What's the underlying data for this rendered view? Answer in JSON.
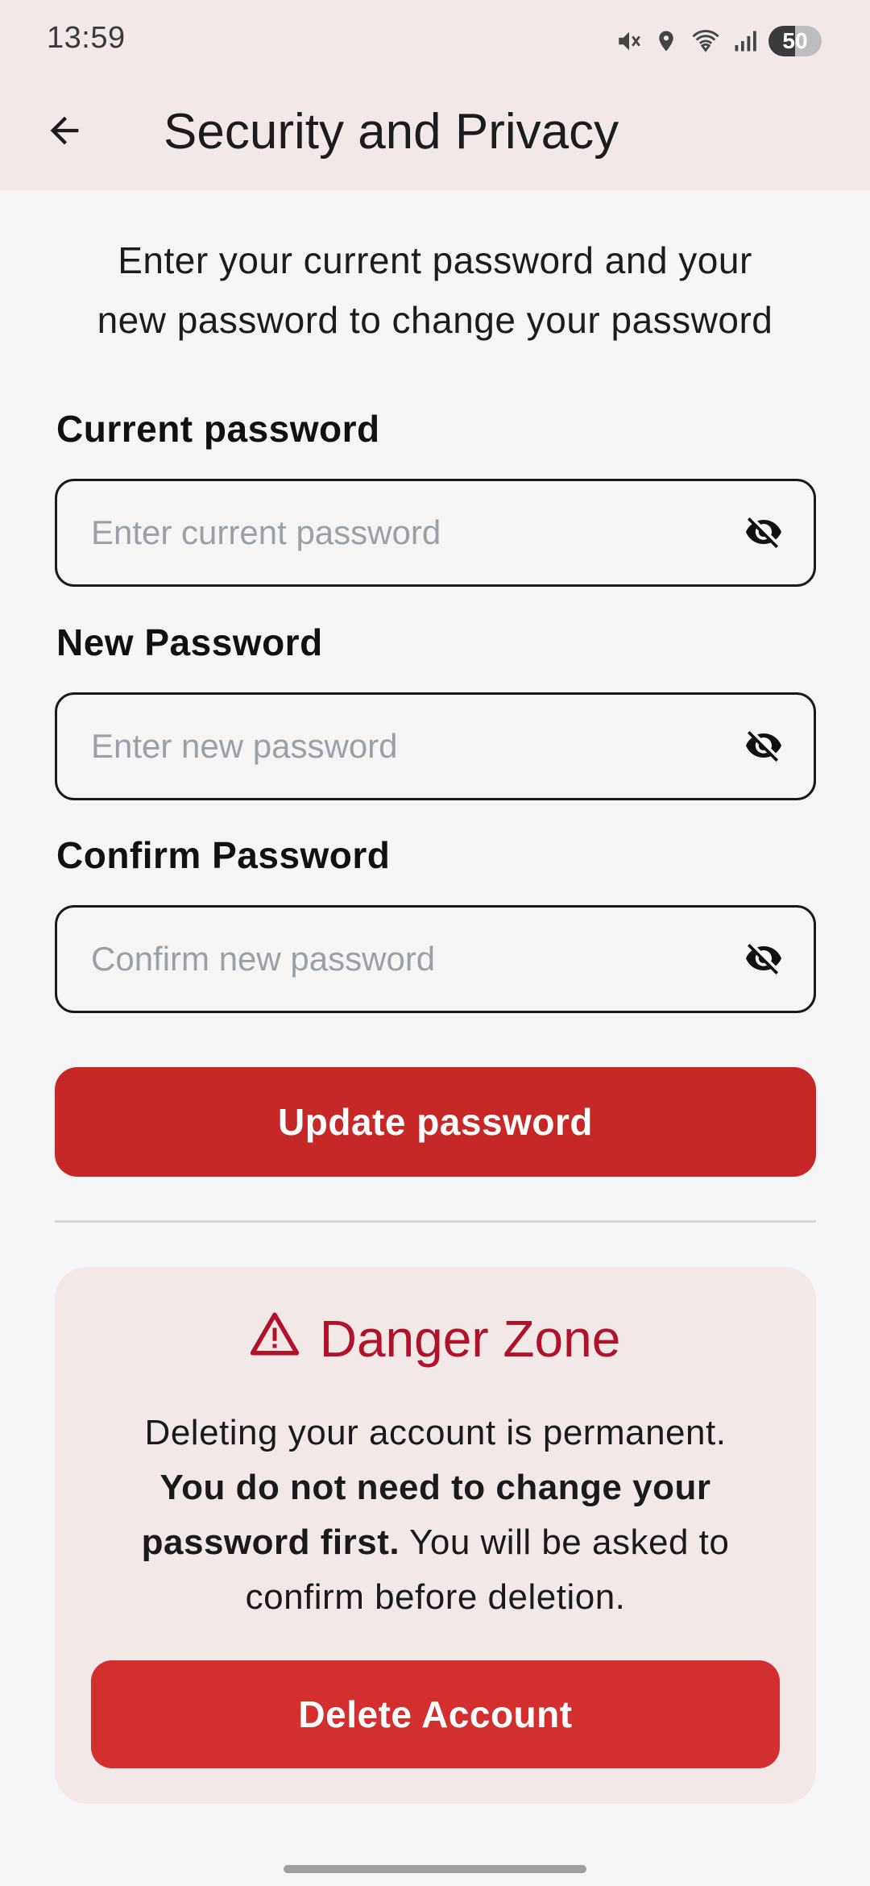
{
  "status_bar": {
    "time": "13:59",
    "battery_level": "50",
    "icons": [
      "mute-icon",
      "location-icon",
      "wifi-icon",
      "signal-icon",
      "battery-icon"
    ]
  },
  "app_bar": {
    "title": "Security and Privacy",
    "back_icon": "arrow-left-icon"
  },
  "intro": {
    "line1": "Enter your current password and your",
    "line2": "new password to change your password"
  },
  "form": {
    "current": {
      "label": "Current password",
      "value": "",
      "placeholder": "Enter current password",
      "toggle_icon": "eye-off-icon"
    },
    "new": {
      "label": "New Password",
      "value": "",
      "placeholder": "Enter new password",
      "toggle_icon": "eye-off-icon"
    },
    "confirm": {
      "label": "Confirm Password",
      "value": "",
      "placeholder": "Confirm new password",
      "toggle_icon": "eye-off-icon"
    },
    "submit_label": "Update password"
  },
  "danger_zone": {
    "icon": "warning-icon",
    "title": "Danger Zone",
    "text_line1": "Deleting your account is permanent.",
    "text_bold": "You do not need to change your password first.",
    "text_rest": " You will be asked to confirm before deletion.",
    "button_label": "Delete Account"
  },
  "colors": {
    "accent": "#c62828",
    "danger_title": "#b0122a",
    "app_bar_bg": "#f3e8e8",
    "page_bg": "#f5f5f5"
  }
}
